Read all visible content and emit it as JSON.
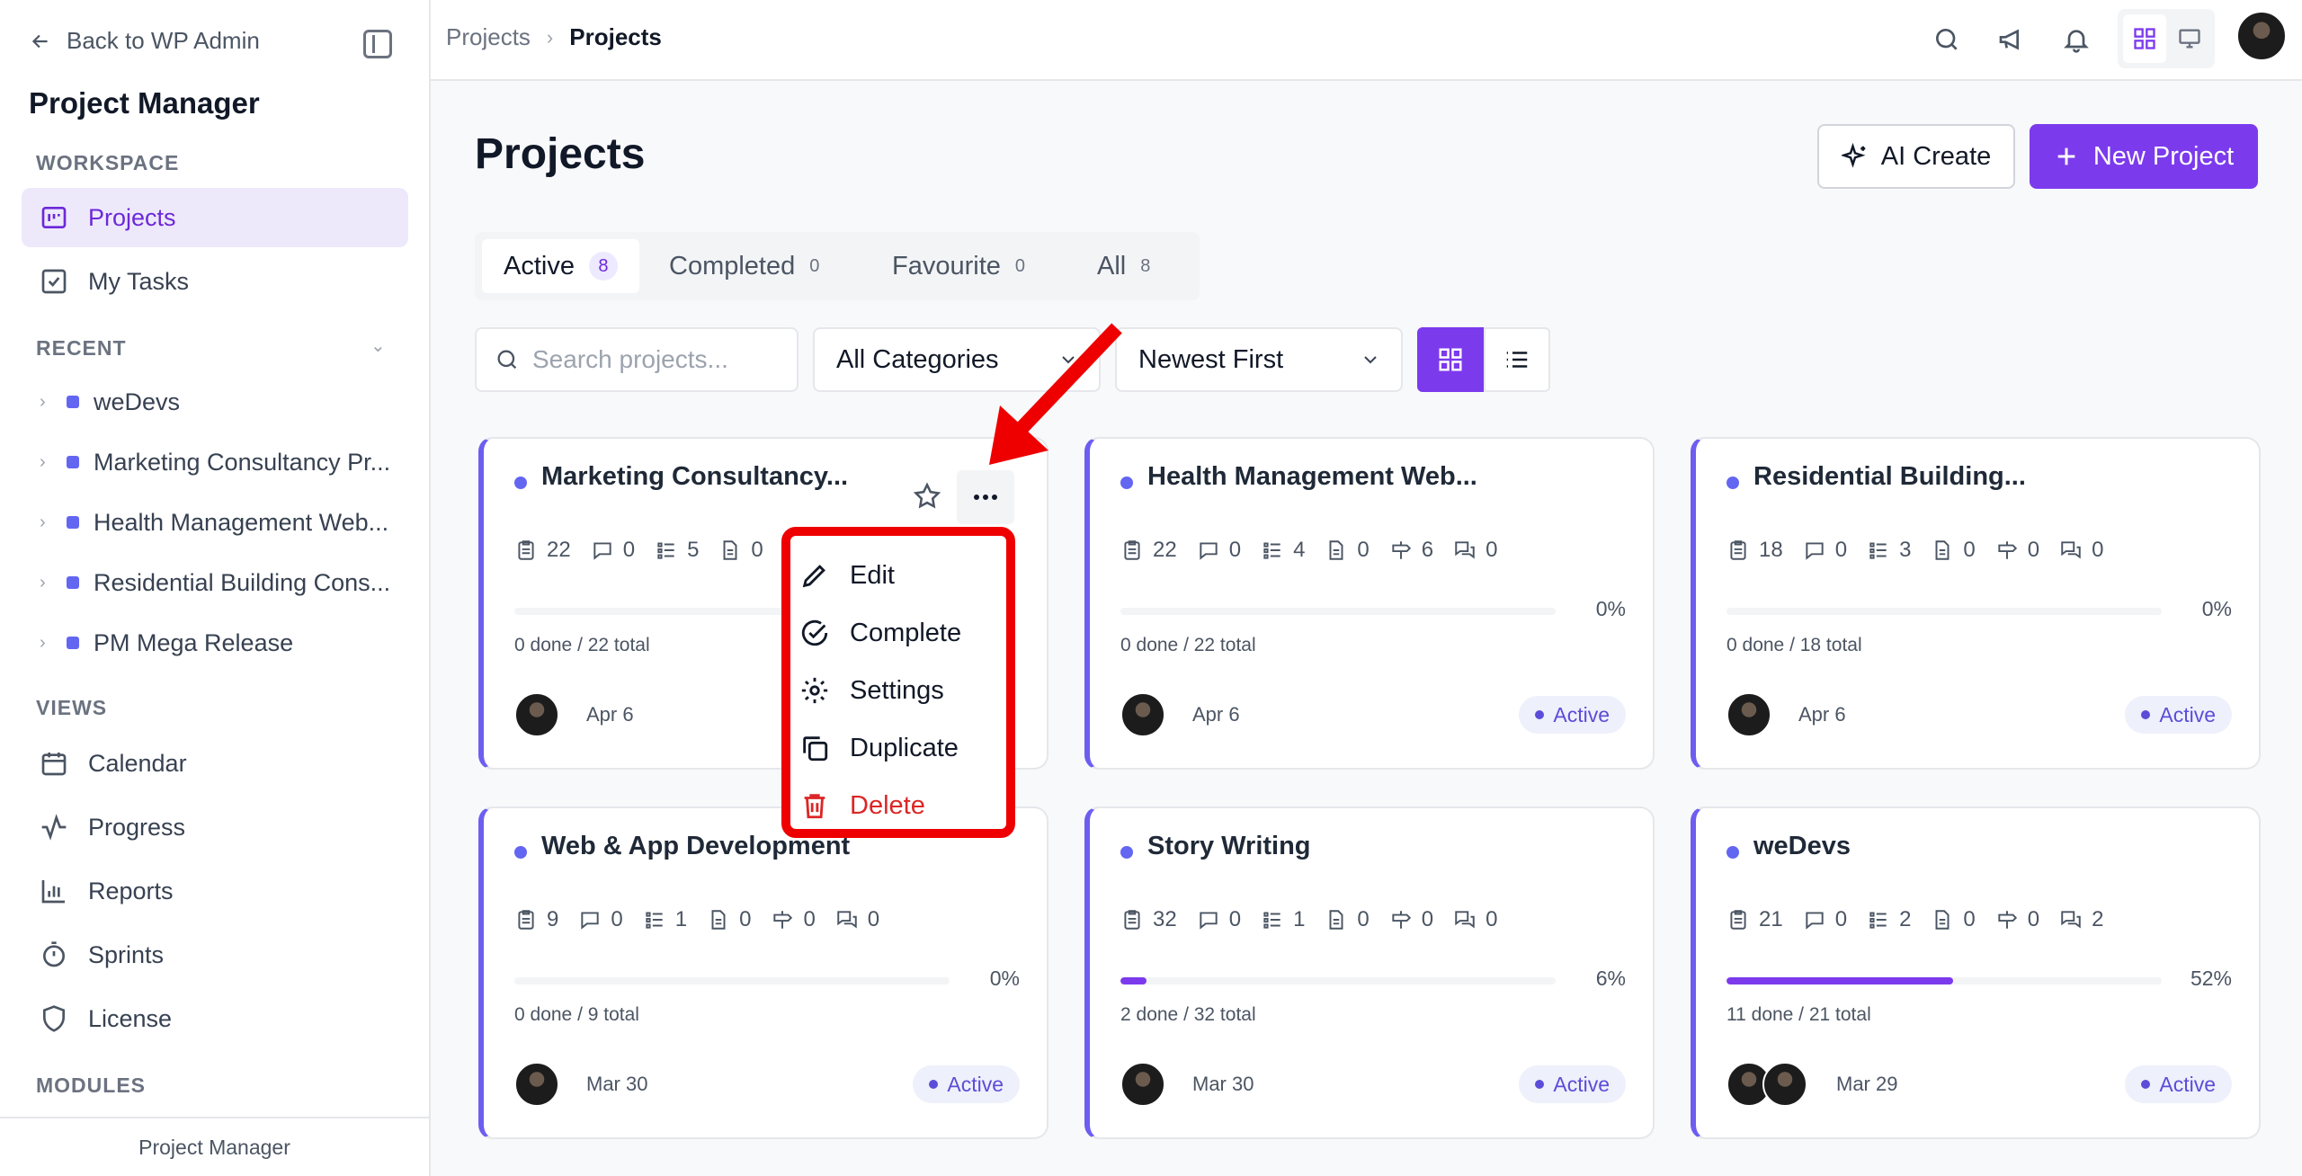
{
  "sidebar": {
    "back_label": "Back to WP Admin",
    "app_title": "Project Manager",
    "workspace_label": "WORKSPACE",
    "workspace_items": [
      {
        "label": "Projects",
        "icon": "projects-icon",
        "active": true
      },
      {
        "label": "My Tasks",
        "icon": "tasks-checkbox-icon"
      }
    ],
    "recent_label": "RECENT",
    "recent_items": [
      {
        "label": "weDevs"
      },
      {
        "label": "Marketing Consultancy Pr..."
      },
      {
        "label": "Health Management Web..."
      },
      {
        "label": "Residential Building Cons..."
      },
      {
        "label": "PM Mega Release"
      }
    ],
    "views_label": "VIEWS",
    "view_items": [
      {
        "label": "Calendar",
        "icon": "calendar-icon"
      },
      {
        "label": "Progress",
        "icon": "activity-icon"
      },
      {
        "label": "Reports",
        "icon": "bar-chart-icon"
      },
      {
        "label": "Sprints",
        "icon": "timer-icon"
      },
      {
        "label": "License",
        "icon": "shield-icon"
      }
    ],
    "modules_label": "MODULES",
    "footer": "Project Manager"
  },
  "topbar": {
    "breadcrumb": [
      "Projects",
      "Projects"
    ]
  },
  "main": {
    "title": "Projects",
    "ai_create_label": "AI Create",
    "new_project_label": "New Project",
    "tabs": [
      {
        "label": "Active",
        "count": "8",
        "active": true
      },
      {
        "label": "Completed",
        "count": "0"
      },
      {
        "label": "Favourite",
        "count": "0"
      },
      {
        "label": "All",
        "count": "8"
      }
    ],
    "search_placeholder": "Search projects...",
    "category_select": "All Categories",
    "sort_select": "Newest First"
  },
  "cards": [
    {
      "title": "Marketing Consultancy...",
      "stats": [
        "22",
        "0",
        "5",
        "0"
      ],
      "percent": "",
      "progress": 0,
      "done": "0 done / 22 total",
      "date": "Apr 6",
      "status": ""
    },
    {
      "title": "Health Management Web...",
      "stats": [
        "22",
        "0",
        "4",
        "0",
        "6",
        "0"
      ],
      "percent": "0%",
      "progress": 0,
      "done": "0 done / 22 total",
      "date": "Apr 6",
      "status": "Active"
    },
    {
      "title": "Residential Building...",
      "stats": [
        "18",
        "0",
        "3",
        "0",
        "0",
        "0"
      ],
      "percent": "0%",
      "progress": 0,
      "done": "0 done / 18 total",
      "date": "Apr 6",
      "status": "Active"
    },
    {
      "title": "Web & App Development",
      "stats": [
        "9",
        "0",
        "1",
        "0",
        "0",
        "0"
      ],
      "percent": "0%",
      "progress": 0,
      "done": "0 done / 9 total",
      "date": "Mar 30",
      "status": "Active"
    },
    {
      "title": "Story Writing",
      "stats": [
        "32",
        "0",
        "1",
        "0",
        "0",
        "0"
      ],
      "percent": "6%",
      "progress": 6,
      "done": "2 done / 32 total",
      "date": "Mar 30",
      "status": "Active"
    },
    {
      "title": "weDevs",
      "stats": [
        "21",
        "0",
        "2",
        "0",
        "0",
        "2"
      ],
      "percent": "52%",
      "progress": 52,
      "done": "11 done / 21 total",
      "date": "Mar 29",
      "status": "Active"
    }
  ],
  "menu": {
    "items": [
      {
        "label": "Edit",
        "icon": "pencil-icon"
      },
      {
        "label": "Complete",
        "icon": "check-circle-icon"
      },
      {
        "label": "Settings",
        "icon": "gear-icon"
      },
      {
        "label": "Duplicate",
        "icon": "copy-icon"
      },
      {
        "label": "Delete",
        "icon": "trash-icon",
        "danger": true
      }
    ]
  },
  "colors": {
    "accent": "#7c3aed",
    "project_dot": "#6366f1",
    "annotation": "#ef0000",
    "danger": "#dc2626"
  }
}
